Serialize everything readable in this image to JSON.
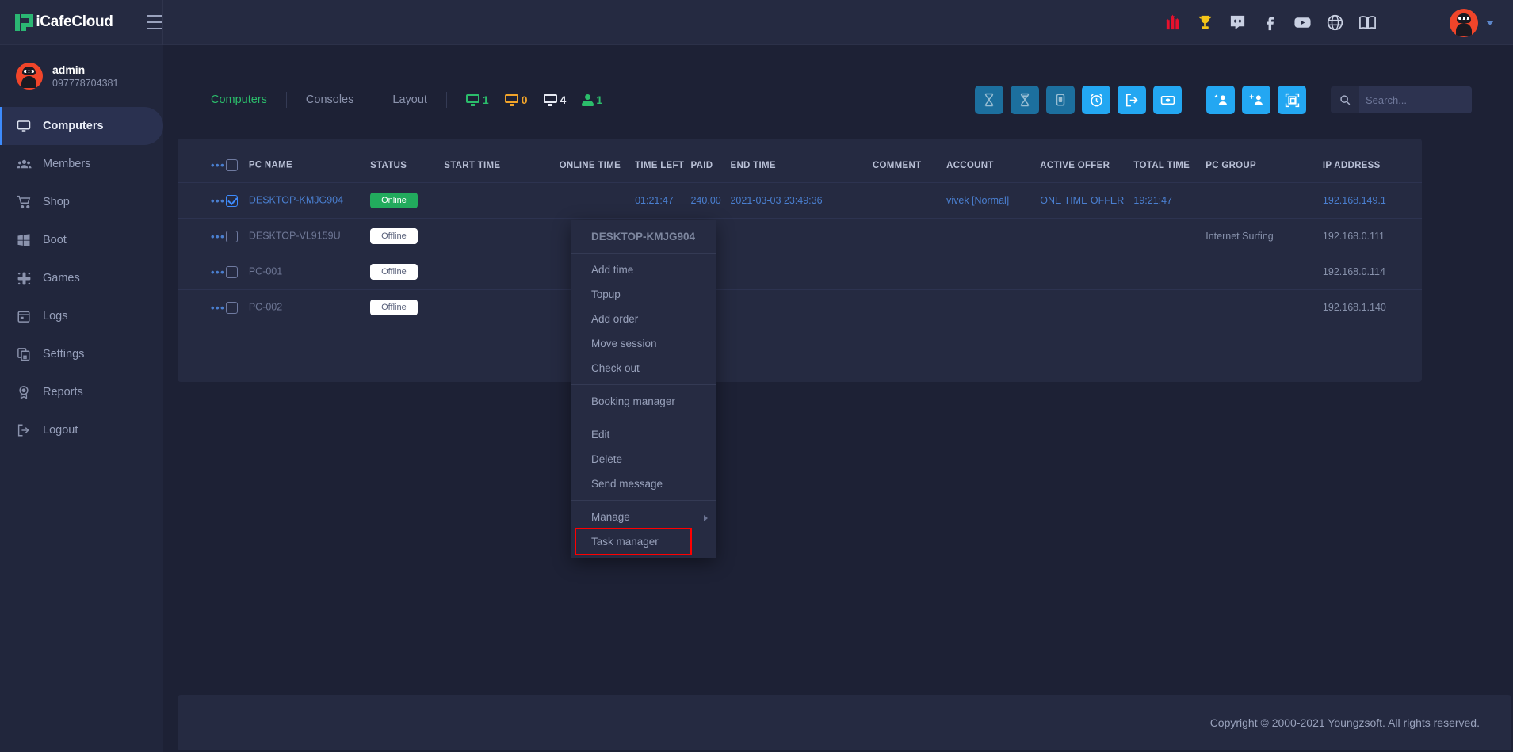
{
  "brand": {
    "name": "iCafeCloud",
    "logo_icon": "icafecloud-logo-icon",
    "menu_icon": "hamburger-menu-icon"
  },
  "topbar": {
    "icons": [
      {
        "name": "gift-ranking-icon",
        "label": "Ranking"
      },
      {
        "name": "trophy-icon",
        "label": "Trophy"
      },
      {
        "name": "discord-icon",
        "label": "Discord"
      },
      {
        "name": "facebook-icon",
        "label": "Facebook"
      },
      {
        "name": "youtube-icon",
        "label": "YouTube"
      },
      {
        "name": "globe-icon",
        "label": "Language"
      },
      {
        "name": "book-icon",
        "label": "Documentation"
      }
    ],
    "avatar_icon": "ninja-avatar-icon",
    "chevron_icon": "chevron-down-icon"
  },
  "sidebar": {
    "user": {
      "name": "admin",
      "phone": "097778704381",
      "avatar_icon": "ninja-avatar-icon"
    },
    "items": [
      {
        "label": "Computers",
        "icon": "monitor-icon",
        "active": true
      },
      {
        "label": "Members",
        "icon": "users-icon",
        "active": false
      },
      {
        "label": "Shop",
        "icon": "cart-icon",
        "active": false
      },
      {
        "label": "Boot",
        "icon": "windows-icon",
        "active": false
      },
      {
        "label": "Games",
        "icon": "gamepad-icon",
        "active": false
      },
      {
        "label": "Logs",
        "icon": "calendar-icon",
        "active": false
      },
      {
        "label": "Settings",
        "icon": "layers-icon",
        "active": false
      },
      {
        "label": "Reports",
        "icon": "badge-icon",
        "active": false
      },
      {
        "label": "Logout",
        "icon": "logout-icon",
        "active": false
      }
    ]
  },
  "tabs": [
    {
      "label": "Computers",
      "active": true
    },
    {
      "label": "Consoles",
      "active": false
    },
    {
      "label": "Layout",
      "active": false
    }
  ],
  "counters": [
    {
      "icon": "monitor-online-icon",
      "value": "1",
      "color": "#2bbd6b"
    },
    {
      "icon": "monitor-warning-icon",
      "value": "0",
      "color": "#f0a32a"
    },
    {
      "icon": "monitor-total-icon",
      "value": "4",
      "color": "#e6e9f2"
    },
    {
      "icon": "user-count-icon",
      "value": "1",
      "color": "#2bbd6b"
    }
  ],
  "toolbar": {
    "buttons": [
      {
        "name": "hourglass-start-button",
        "icon": "hourglass-icon",
        "state": "disabled"
      },
      {
        "name": "hourglass-end-button",
        "icon": "hourglass-end-icon",
        "state": "disabled"
      },
      {
        "name": "lock-button",
        "icon": "lock-icon",
        "state": "disabled"
      },
      {
        "name": "alarm-button",
        "icon": "alarm-clock-icon",
        "state": "enabled"
      },
      {
        "name": "logout-session-button",
        "icon": "sign-out-icon",
        "state": "enabled"
      },
      {
        "name": "cash-button",
        "icon": "money-icon",
        "state": "enabled"
      },
      {
        "name": "add-member-button",
        "icon": "user-plus-icon",
        "state": "enabled"
      },
      {
        "name": "add-guest-button",
        "icon": "user-add-icon",
        "state": "enabled"
      },
      {
        "name": "screenshot-button",
        "icon": "screen-capture-icon",
        "state": "enabled"
      }
    ]
  },
  "search": {
    "placeholder": "Search...",
    "value": "",
    "icon": "search-icon"
  },
  "table": {
    "columns": [
      "PC NAME",
      "STATUS",
      "START TIME",
      "ONLINE TIME",
      "TIME LEFT",
      "PAID",
      "END TIME",
      "COMMENT",
      "ACCOUNT",
      "ACTIVE OFFER",
      "TOTAL TIME",
      "PC GROUP",
      "IP ADDRESS"
    ],
    "rows": [
      {
        "selected": true,
        "pc_name": "DESKTOP-KMJG904",
        "status": "Online",
        "start_time": "",
        "online_time": "",
        "time_left": "01:21:47",
        "paid": "240.00",
        "end_time": "2021-03-03 23:49:36",
        "comment": "",
        "account": "vivek [Normal]",
        "active_offer": "ONE TIME OFFER",
        "total_time": "19:21:47",
        "pc_group": "",
        "ip_address": "192.168.149.1"
      },
      {
        "selected": false,
        "pc_name": "DESKTOP-VL9159U",
        "status": "Offline",
        "start_time": "",
        "online_time": "",
        "time_left": "",
        "paid": "",
        "end_time": "",
        "comment": "",
        "account": "",
        "active_offer": "",
        "total_time": "",
        "pc_group": "Internet Surfing",
        "ip_address": "192.168.0.111"
      },
      {
        "selected": false,
        "pc_name": "PC-001",
        "status": "Offline",
        "start_time": "",
        "online_time": "",
        "time_left": "",
        "paid": "",
        "end_time": "",
        "comment": "",
        "account": "",
        "active_offer": "",
        "total_time": "",
        "pc_group": "",
        "ip_address": "192.168.0.114"
      },
      {
        "selected": false,
        "pc_name": "PC-002",
        "status": "Offline",
        "start_time": "",
        "online_time": "",
        "time_left": "",
        "paid": "",
        "end_time": "",
        "comment": "",
        "account": "",
        "active_offer": "",
        "total_time": "",
        "pc_group": "",
        "ip_address": "192.168.1.140"
      }
    ]
  },
  "context_menu": {
    "title": "DESKTOP-KMJG904",
    "groups": [
      {
        "items": [
          {
            "label": "Add time",
            "highlighted": false,
            "submenu": false
          },
          {
            "label": "Topup",
            "highlighted": false,
            "submenu": false
          },
          {
            "label": "Add order",
            "highlighted": false,
            "submenu": false
          },
          {
            "label": "Move session",
            "highlighted": false,
            "submenu": false
          },
          {
            "label": "Check out",
            "highlighted": false,
            "submenu": false
          }
        ]
      },
      {
        "items": [
          {
            "label": "Booking manager",
            "highlighted": false,
            "submenu": false
          }
        ]
      },
      {
        "items": [
          {
            "label": "Edit",
            "highlighted": false,
            "submenu": false
          },
          {
            "label": "Delete",
            "highlighted": false,
            "submenu": false
          },
          {
            "label": "Send message",
            "highlighted": false,
            "submenu": false
          }
        ]
      },
      {
        "items": [
          {
            "label": "Manage",
            "highlighted": false,
            "submenu": true
          },
          {
            "label": "Task manager",
            "highlighted": true,
            "submenu": false
          }
        ]
      }
    ]
  },
  "footer": {
    "copyright": "Copyright © 2000-2021 Youngzsoft. All rights reserved."
  },
  "colors": {
    "page_bg": "#1d2135",
    "panel_bg": "#252a41",
    "sidebar_bg": "#21263c",
    "accent_blue": "#23a7f2",
    "accent_green": "#2bbd6b",
    "link_blue": "#4a7fd0",
    "avatar_red": "#f0452a",
    "highlight_red": "#ff0000"
  }
}
